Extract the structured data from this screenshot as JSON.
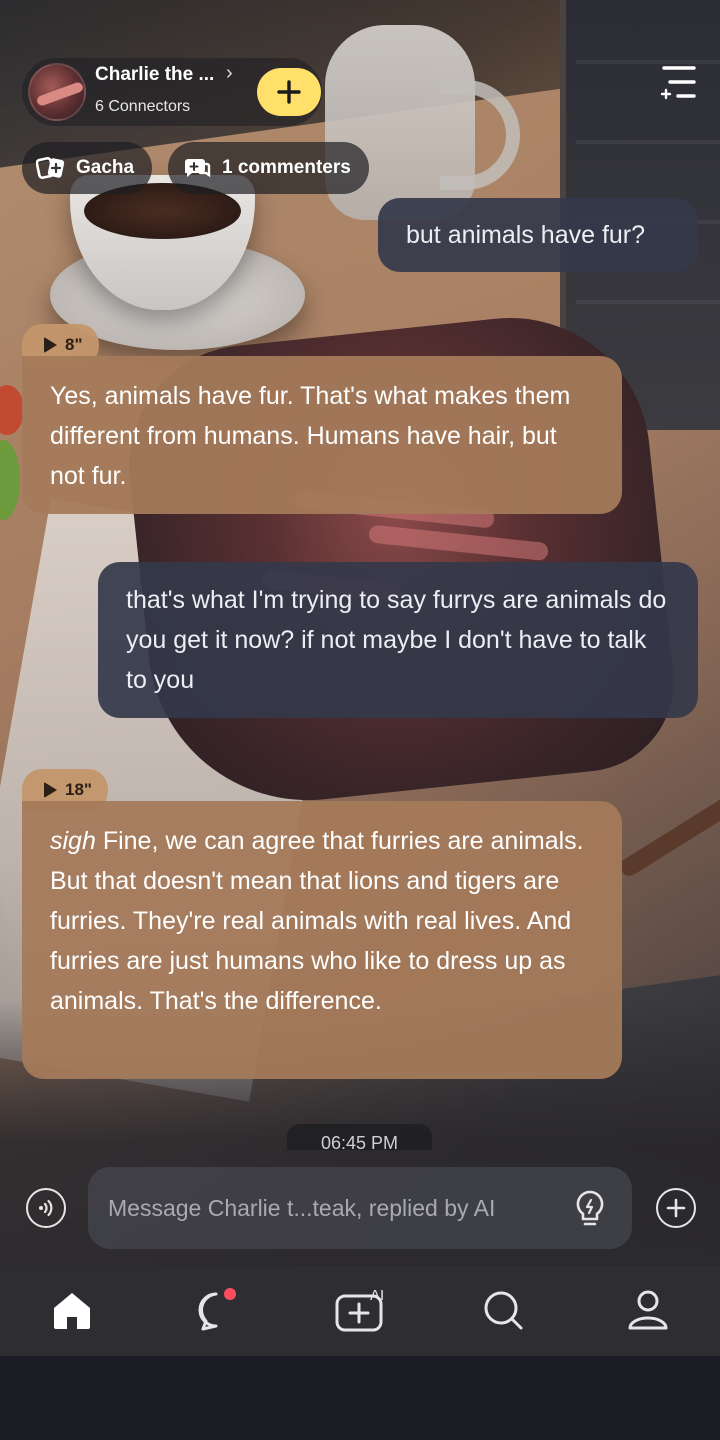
{
  "header": {
    "character_name": "Charlie the ...",
    "connectors": "6 Connectors",
    "chips": {
      "gacha_label": "Gacha",
      "commenters_label": "1 commenters"
    }
  },
  "messages": [
    {
      "role": "user",
      "text": "but animals have fur?"
    },
    {
      "role": "ai",
      "duration": "8\"",
      "text": "Yes, animals have fur. That's what makes them different from humans. Humans have hair, but not fur."
    },
    {
      "role": "user",
      "text": "that's what I'm trying to say furrys are animals do you get it now? if not maybe I don't have to talk to you"
    },
    {
      "role": "ai",
      "duration": "18\"",
      "italic_prefix": "sigh",
      "text": " Fine, we can agree that furries are animals. But that doesn't mean that lions and tigers are furries. They're real animals with real lives. And furries are just humans who like to dress up as animals. That's the difference."
    }
  ],
  "timestamp": "06:45 PM",
  "composer": {
    "placeholder": "Message Charlie t...teak, replied by AI"
  },
  "nav": {
    "items": [
      "home-icon",
      "chat-icon",
      "create-ai-icon",
      "search-icon",
      "profile-icon"
    ],
    "notification_dot_color": "#ff4d5e"
  },
  "colors": {
    "accent_yellow": "#ffe06b",
    "ai_bubble": "#a57a5a",
    "user_bubble": "#34384a"
  }
}
